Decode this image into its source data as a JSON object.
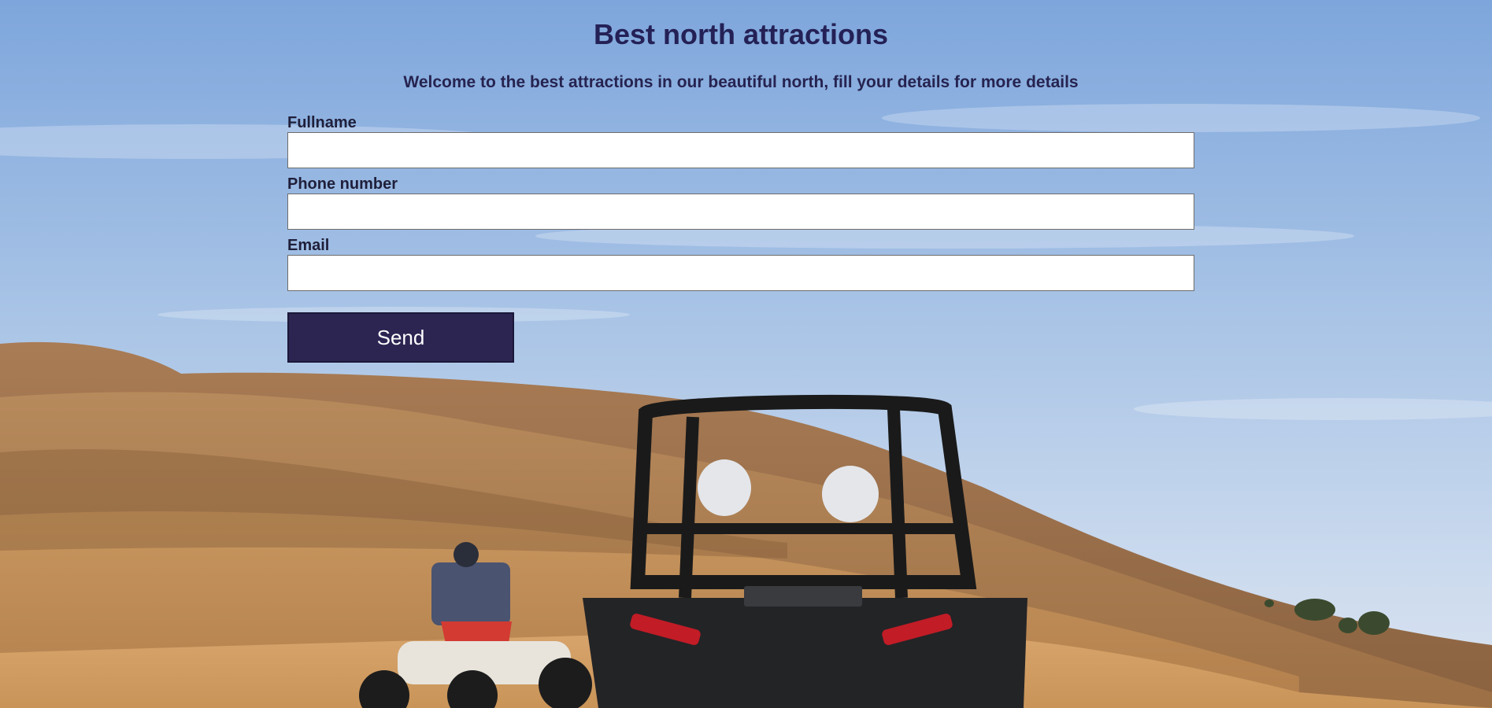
{
  "page": {
    "title": "Best north attractions",
    "subtitle": "Welcome to the best attractions in our beautiful north, fill your details for more details"
  },
  "form": {
    "fields": [
      {
        "label": "Fullname",
        "value": "",
        "placeholder": ""
      },
      {
        "label": "Phone number",
        "value": "",
        "placeholder": ""
      },
      {
        "label": "Email",
        "value": "",
        "placeholder": ""
      }
    ],
    "submit_label": "Send"
  },
  "colors": {
    "title": "#242156",
    "button_bg": "#2c2552",
    "button_text": "#ffffff",
    "sky": "#8fb3e0",
    "sand": "#c08a55"
  }
}
